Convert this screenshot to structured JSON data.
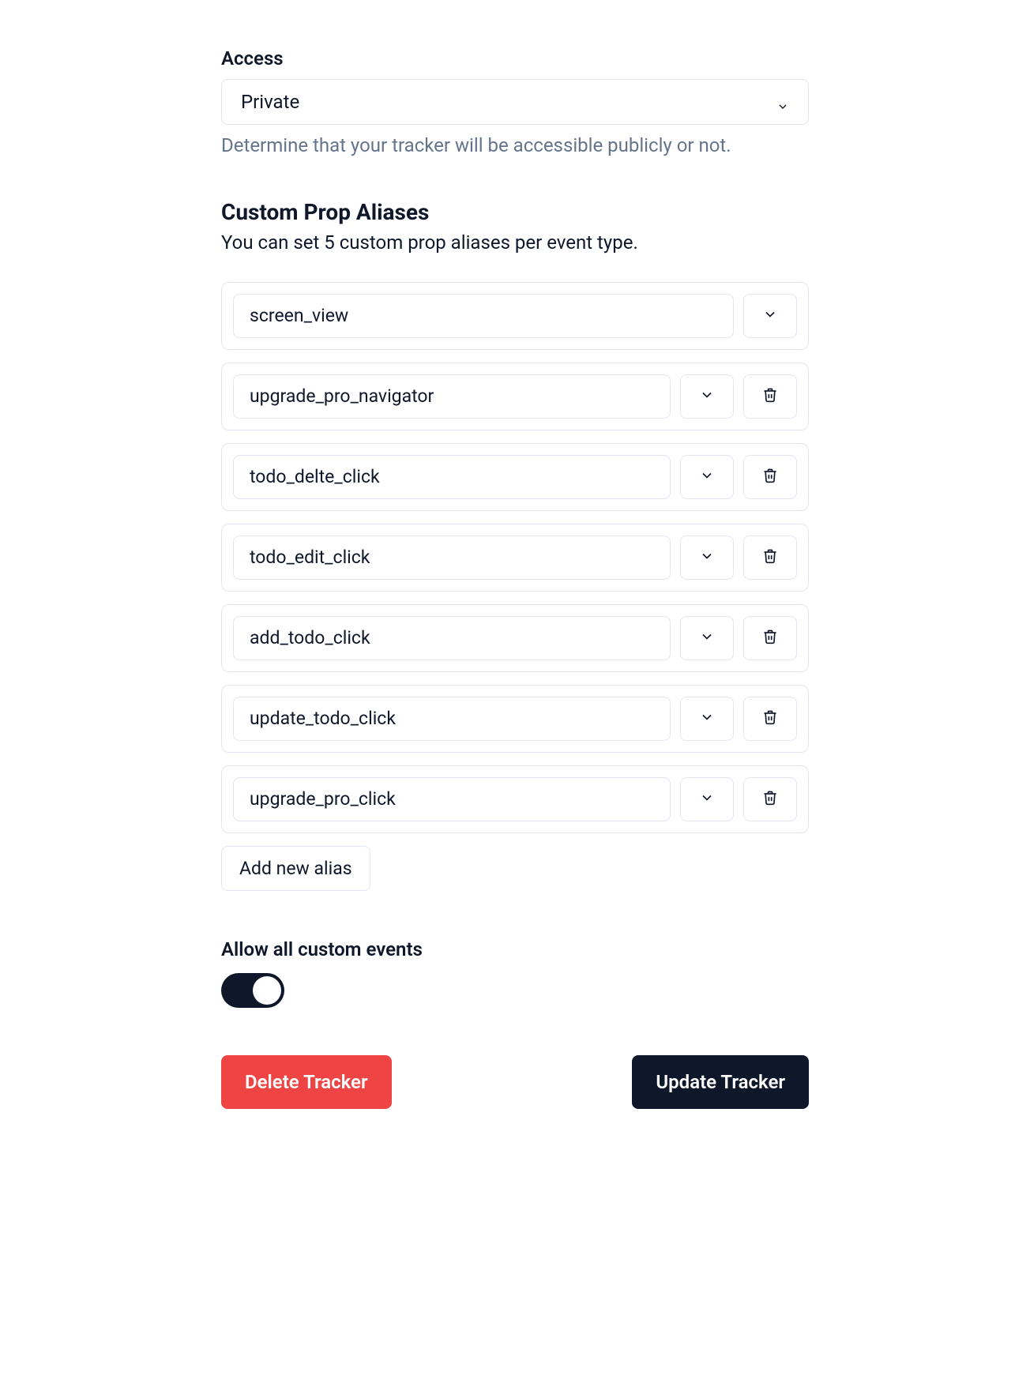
{
  "access": {
    "label": "Access",
    "selected": "Private",
    "helper": "Determine that your tracker will be accessible publicly or not."
  },
  "aliases": {
    "title": "Custom Prop Aliases",
    "subtitle": "You can set 5 custom prop aliases per event type.",
    "rows": [
      {
        "value": "screen_view",
        "hasDelete": false
      },
      {
        "value": "upgrade_pro_navigator",
        "hasDelete": true
      },
      {
        "value": "todo_delte_click",
        "hasDelete": true
      },
      {
        "value": "todo_edit_click",
        "hasDelete": true
      },
      {
        "value": "add_todo_click",
        "hasDelete": true
      },
      {
        "value": "update_todo_click",
        "hasDelete": true
      },
      {
        "value": "upgrade_pro_click",
        "hasDelete": true
      }
    ],
    "addButton": "Add new alias"
  },
  "customEvents": {
    "label": "Allow all custom events",
    "enabled": true
  },
  "actions": {
    "delete": "Delete Tracker",
    "update": "Update Tracker"
  }
}
